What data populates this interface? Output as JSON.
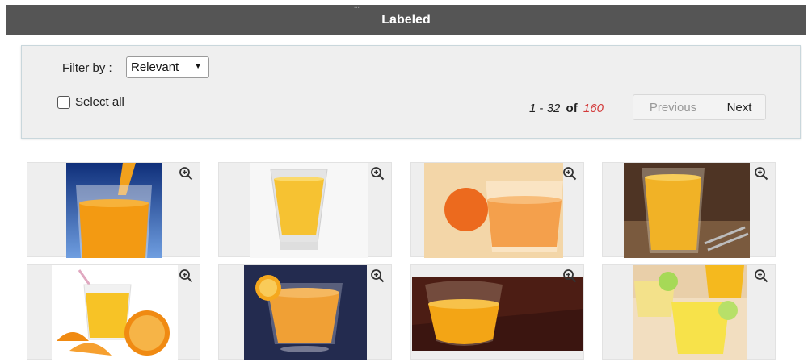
{
  "window": {
    "title": "Labeled",
    "faint_caption": "..."
  },
  "toolbar": {
    "filter_label": "Filter by :",
    "filter_value": "Relevant",
    "select_all_label": "Select all",
    "range_start": "1",
    "range_sep": " - ",
    "range_end": "32",
    "range_of": "of",
    "range_total": "160",
    "previous_label": "Previous",
    "next_label": "Next"
  },
  "colors": {
    "header_bg": "#555555",
    "panel_bg": "#efefef",
    "total_red": "#d33a3a"
  },
  "icons": {
    "zoom": "zoom-in-icon",
    "dropdown": "caret-down-icon"
  },
  "tiles": [
    {
      "subject": "juice-pour-blue"
    },
    {
      "subject": "tall-glass-white"
    },
    {
      "subject": "glass-with-orange"
    },
    {
      "subject": "glass-on-table"
    },
    {
      "subject": "glass-oranges-straw"
    },
    {
      "subject": "glass-navy-slice"
    },
    {
      "subject": "glass-dark-wood"
    },
    {
      "subject": "glasses-lime"
    }
  ]
}
